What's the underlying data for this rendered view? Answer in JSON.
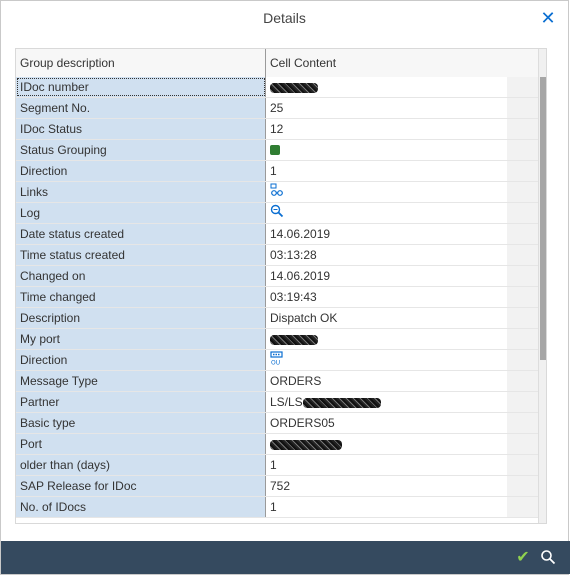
{
  "dialog": {
    "title": "Details",
    "close_icon": "close-icon"
  },
  "table": {
    "columns": [
      "Group description",
      "Cell Content"
    ],
    "rows": [
      {
        "label": "IDoc number",
        "value": "",
        "kind": "redacted"
      },
      {
        "label": "Segment No.",
        "value": "25",
        "kind": "text"
      },
      {
        "label": "IDoc Status",
        "value": "12",
        "kind": "text"
      },
      {
        "label": "Status Grouping",
        "value": "",
        "kind": "status-icon"
      },
      {
        "label": "Direction",
        "value": "1",
        "kind": "text"
      },
      {
        "label": "Links",
        "value": "",
        "kind": "links-icon"
      },
      {
        "label": "Log",
        "value": "",
        "kind": "log-icon"
      },
      {
        "label": "Date status created",
        "value": "14.06.2019",
        "kind": "text"
      },
      {
        "label": "Time status created",
        "value": "03:13:28",
        "kind": "text"
      },
      {
        "label": "Changed on",
        "value": "14.06.2019",
        "kind": "text"
      },
      {
        "label": "Time changed",
        "value": "03:19:43",
        "kind": "text"
      },
      {
        "label": "Description",
        "value": "Dispatch OK",
        "kind": "text"
      },
      {
        "label": "My port",
        "value": "",
        "kind": "redacted"
      },
      {
        "label": "Direction",
        "value": "",
        "kind": "direction-icon"
      },
      {
        "label": "Message Type",
        "value": "ORDERS",
        "kind": "text"
      },
      {
        "label": "Partner",
        "value": "LS/LS",
        "kind": "text-redacted"
      },
      {
        "label": "Basic type",
        "value": "ORDERS05",
        "kind": "text"
      },
      {
        "label": "Port",
        "value": "",
        "kind": "redacted"
      },
      {
        "label": "older than (days)",
        "value": "1",
        "kind": "text"
      },
      {
        "label": "SAP Release for IDoc",
        "value": "752",
        "kind": "text"
      },
      {
        "label": "No. of IDocs",
        "value": "1",
        "kind": "text"
      }
    ]
  },
  "footer": {
    "ok_icon": "checkmark-icon",
    "search_icon": "search-icon"
  },
  "colors": {
    "footer_bg": "#354a5f",
    "label_bg": "#d0e0f0",
    "status_green": "#2f7d32",
    "accent": "#0a6ed1",
    "ok_green": "#8fd14f"
  }
}
